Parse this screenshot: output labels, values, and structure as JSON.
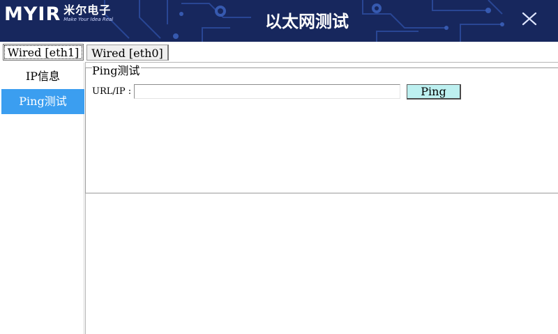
{
  "header": {
    "logo_mark": "MYIR",
    "logo_cn": "米尔电子",
    "logo_slogan": "Make Your Idea Real",
    "title": "以太网测试",
    "close_icon": "close-icon"
  },
  "tabs": [
    {
      "label": "Wired [eth1]",
      "active": true
    },
    {
      "label": "Wired [eth0]",
      "active": false
    }
  ],
  "sidebar": {
    "items": [
      {
        "label": "IP信息",
        "selected": false
      },
      {
        "label": "Ping测试",
        "selected": true
      }
    ]
  },
  "ping": {
    "group_title": "Ping测试",
    "field_label": "URL/IP :",
    "input_value": "",
    "button_label": "Ping"
  },
  "colors": {
    "header_bg": "#17275d",
    "selected_item": "#3b9ef0",
    "ping_button": "#bdf0f0"
  }
}
